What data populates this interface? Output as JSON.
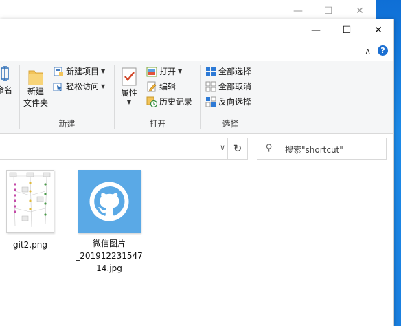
{
  "back_window": {
    "controls": {
      "minimize": "—",
      "maximize": "☐",
      "close": "✕"
    }
  },
  "window": {
    "controls": {
      "minimize": "—",
      "maximize": "☐",
      "close": "✕"
    },
    "help_chevron": "∧",
    "help_symbol": "?"
  },
  "ribbon": {
    "organize_partial": {
      "rename_label": "命名"
    },
    "new_group": {
      "label": "新建",
      "new_folder_label_1": "新建",
      "new_folder_label_2": "文件夹",
      "new_item_label": "新建项目",
      "easy_access_label": "轻松访问"
    },
    "open_group": {
      "label": "打开",
      "properties_label": "属性",
      "open_label": "打开",
      "edit_label": "编辑",
      "history_label": "历史记录"
    },
    "select_group": {
      "label": "选择",
      "select_all_label": "全部选择",
      "select_none_label": "全部取消",
      "invert_label": "反向选择"
    }
  },
  "address": {
    "dropdown": "∨",
    "refresh": "↻"
  },
  "search": {
    "icon": "search-icon",
    "placeholder": "搜索\"shortcut\""
  },
  "files": [
    {
      "name": "git2.png",
      "icon": "image-thumbnail"
    },
    {
      "name_line1": "微信图片",
      "name_line2": "_201912231547",
      "name_line3": "14.jpg",
      "icon": "github-logo"
    }
  ],
  "colors": {
    "accent": "#1b6fd2",
    "ribbon_bg": "#f5f6f7",
    "github_tile": "#5aa9e6",
    "desktop": "#1e88e5"
  }
}
